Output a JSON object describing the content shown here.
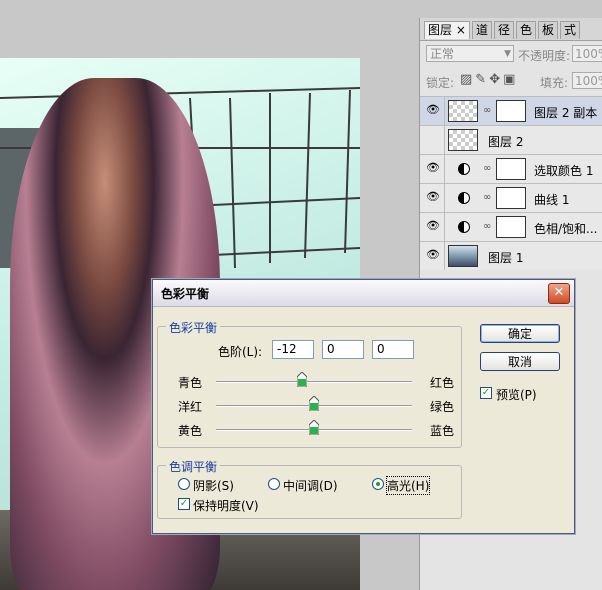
{
  "layers_panel": {
    "tabs": [
      {
        "label": "图层",
        "close": "×"
      },
      {
        "label": "道"
      },
      {
        "label": "径"
      },
      {
        "label": "色"
      },
      {
        "label": "板"
      },
      {
        "label": "式"
      }
    ],
    "blend_mode": "正常",
    "opacity_label": "不透明度:",
    "opacity_value": "100%",
    "lock_label": "锁定:",
    "fill_label": "填充:",
    "fill_value": "100%",
    "layers": [
      {
        "name": "图层 2 副本",
        "type": "pixel-with-mask",
        "selected": true
      },
      {
        "name": "图层 2",
        "type": "pixel",
        "selected": false
      },
      {
        "name": "选取颜色 1",
        "type": "adjustment",
        "selected": false
      },
      {
        "name": "曲线 1",
        "type": "adjustment",
        "selected": false
      },
      {
        "name": "色相/饱和...",
        "type": "adjustment",
        "selected": false
      },
      {
        "name": "图层 1",
        "type": "image",
        "selected": false
      }
    ]
  },
  "dialog": {
    "title": "色彩平衡",
    "color_balance_group": "色彩平衡",
    "levels_label": "色阶(L):",
    "levels": [
      "-12",
      "0",
      "0"
    ],
    "sliders": [
      {
        "left": "青色",
        "right": "红色",
        "value": -12
      },
      {
        "left": "洋红",
        "right": "绿色",
        "value": 0
      },
      {
        "left": "黄色",
        "right": "蓝色",
        "value": 0
      }
    ],
    "tone_balance_group": "色调平衡",
    "tones": [
      {
        "label": "阴影(S)",
        "checked": false
      },
      {
        "label": "中间调(D)",
        "checked": false
      },
      {
        "label": "高光(H)",
        "checked": true
      }
    ],
    "preserve_luminosity": {
      "label": "保持明度(V)",
      "checked": true
    },
    "ok_label": "确定",
    "cancel_label": "取消",
    "preview": {
      "label": "预览(P)",
      "checked": true
    }
  }
}
